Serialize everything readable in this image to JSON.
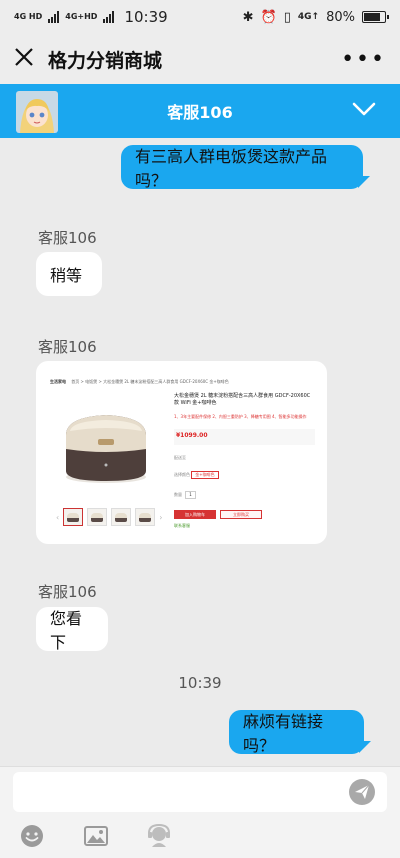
{
  "status_bar": {
    "network_1": "4G HD",
    "network_2": "4G+HD",
    "time": "10:39",
    "network_right": "4G↑",
    "battery": "80%",
    "battery_level": 0.8
  },
  "app_bar": {
    "title": "格力分销商城"
  },
  "chat_header": {
    "title": "客服106",
    "accent_color": "#1aa7ef"
  },
  "messages": [
    {
      "from": "me",
      "text": "有三高人群电饭煲这款产品吗？"
    },
    {
      "from": "agent",
      "sender": "客服106",
      "text": "稍等"
    },
    {
      "from": "agent",
      "sender": "客服106",
      "type": "image"
    },
    {
      "from": "agent",
      "sender": "客服106",
      "text": "您看下"
    },
    {
      "from": "me",
      "text": "麻烦有链接吗？"
    }
  ],
  "timestamp": "10:39",
  "product_card": {
    "store": "生活家电",
    "breadcrumb": "首页 > 电饭煲 > 大松金穗煲 2L 糖末淀粉搭配三高人群食用 GDCF-20X60C 金+咖啡色",
    "title": "大松金穗煲 2L 糖末淀粉搭配含三高人群食用 GDCF-20X60C款 WiFi 金+咖啡色",
    "promo": "1、3年主要配件保修 2、内胆三重防护 3、降糖专用图 4、智能多功能操作",
    "price": "¥1099.00",
    "labels": [
      "配送至",
      "选择颜色",
      "数量"
    ],
    "color_option": "金+咖啡色",
    "quantity": "1",
    "add_to_cart": "加入购物车",
    "buy_now": "立即购买",
    "contact": "联系客服"
  },
  "input": {
    "placeholder": ""
  }
}
